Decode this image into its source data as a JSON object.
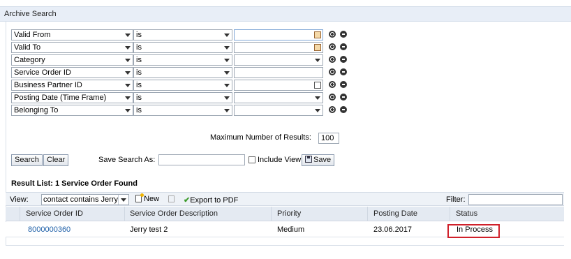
{
  "title": "Archive Search",
  "criteria": [
    {
      "field": "Valid From",
      "op": "is",
      "value_icon": "calendar-icon"
    },
    {
      "field": "Valid To",
      "op": "is",
      "value_icon": "calendar-icon"
    },
    {
      "field": "Category",
      "op": "is",
      "value_icon": "dropdown-arrow"
    },
    {
      "field": "Service Order ID",
      "op": "is",
      "value_icon": ""
    },
    {
      "field": "Business Partner ID",
      "op": "is",
      "value_icon": "value-help-icon"
    },
    {
      "field": "Posting Date (Time Frame)",
      "op": "is",
      "value_icon": "dropdown-arrow"
    },
    {
      "field": "Belonging To",
      "op": "is",
      "value_icon": "dropdown-arrow"
    }
  ],
  "max_results_label": "Maximum Number of Results:",
  "max_results_value": "100",
  "buttons": {
    "search": "Search",
    "clear": "Clear",
    "save": "Save"
  },
  "save_search_label": "Save Search As:",
  "include_view_label": "Include View",
  "result_title": "Result List: 1 Service Order Found",
  "toolbar": {
    "view_label": "View:",
    "view_value": "contact contains Jerry",
    "new_label": "New",
    "export_label": "Export to PDF",
    "filter_label": "Filter:"
  },
  "columns": [
    "Service Order ID",
    "Service Order Description",
    "Priority",
    "Posting Date",
    "Status"
  ],
  "rows": [
    {
      "id": "8000000360",
      "description": "Jerry test 2",
      "priority": "Medium",
      "posting_date": "23.06.2017",
      "status": "In Process"
    }
  ],
  "colors": {
    "highlight": "#d0202a",
    "link": "#1d5fa8",
    "header_bg": "#e4eaf2"
  }
}
